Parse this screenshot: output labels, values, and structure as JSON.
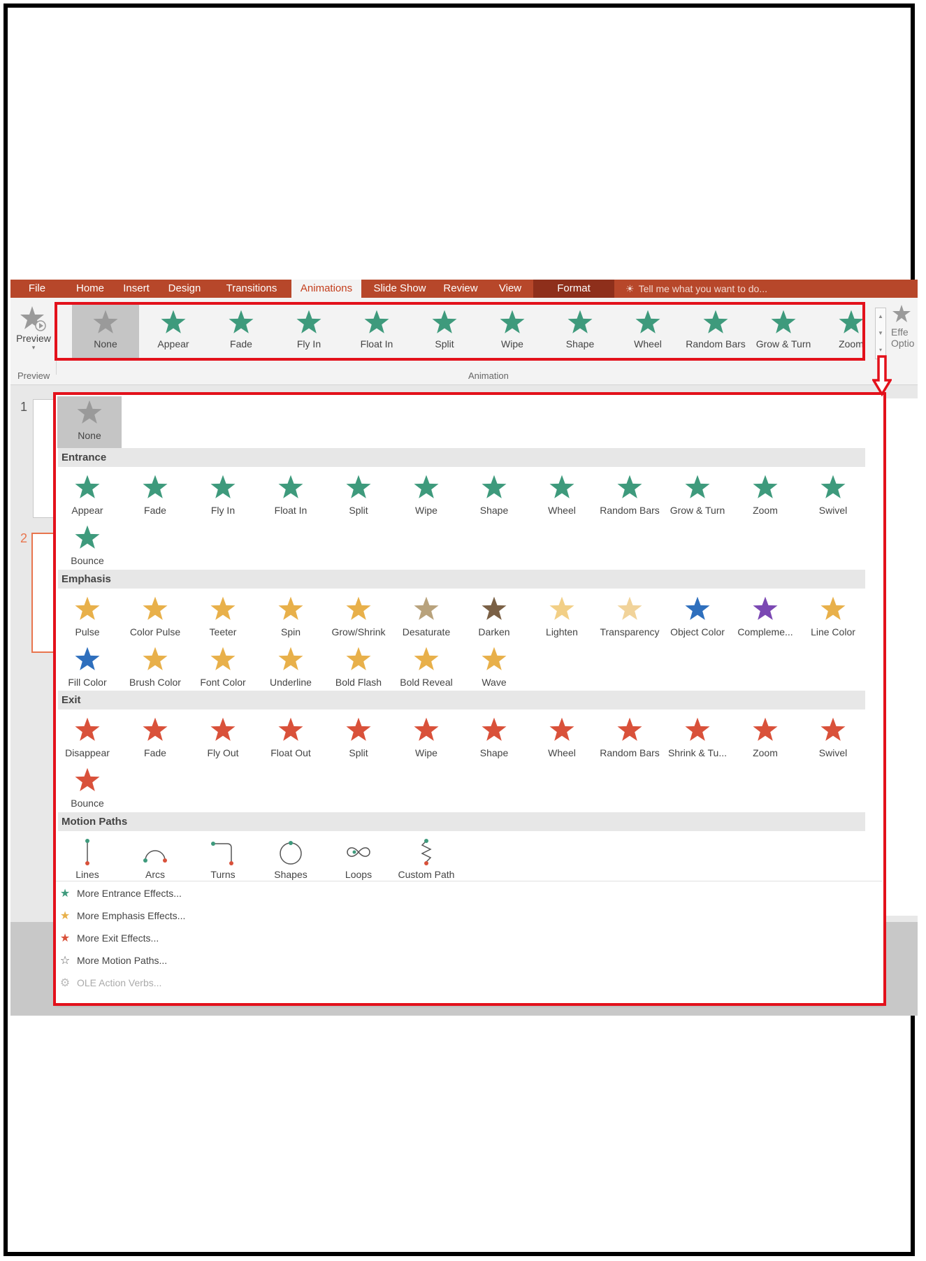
{
  "tabs": [
    {
      "label": "File"
    },
    {
      "label": "Home"
    },
    {
      "label": "Insert"
    },
    {
      "label": "Design"
    },
    {
      "label": "Transitions"
    },
    {
      "label": "Animations"
    },
    {
      "label": "Slide Show"
    },
    {
      "label": "Review"
    },
    {
      "label": "View"
    },
    {
      "label": "Format"
    }
  ],
  "tell_me": "Tell me what you want to do...",
  "preview": {
    "button_label": "Preview",
    "group_label": "Preview"
  },
  "ribbon_gallery": {
    "group_label": "Animation",
    "items": [
      "None",
      "Appear",
      "Fade",
      "Fly In",
      "Float In",
      "Split",
      "Wipe",
      "Shape",
      "Wheel",
      "Random Bars",
      "Grow & Turn",
      "Zoom"
    ]
  },
  "effect_options_partial": [
    "Effe",
    "Optio"
  ],
  "slide_numbers": [
    "1",
    "2"
  ],
  "panel": {
    "none_label": "None",
    "sections": [
      {
        "title": "Entrance",
        "items": [
          "Appear",
          "Fade",
          "Fly In",
          "Float In",
          "Split",
          "Wipe",
          "Shape",
          "Wheel",
          "Random Bars",
          "Grow & Turn",
          "Zoom",
          "Swivel",
          "Bounce"
        ]
      },
      {
        "title": "Emphasis",
        "items": [
          "Pulse",
          "Color Pulse",
          "Teeter",
          "Spin",
          "Grow/Shrink",
          "Desaturate",
          "Darken",
          "Lighten",
          "Transparency",
          "Object Color",
          "Compleme...",
          "Line Color",
          "Fill Color",
          "Brush Color",
          "Font Color",
          "Underline",
          "Bold Flash",
          "Bold Reveal",
          "Wave"
        ]
      },
      {
        "title": "Exit",
        "items": [
          "Disappear",
          "Fade",
          "Fly Out",
          "Float Out",
          "Split",
          "Wipe",
          "Shape",
          "Wheel",
          "Random Bars",
          "Shrink & Tu...",
          "Zoom",
          "Swivel",
          "Bounce"
        ]
      },
      {
        "title": "Motion Paths",
        "items": [
          "Lines",
          "Arcs",
          "Turns",
          "Shapes",
          "Loops",
          "Custom Path"
        ]
      }
    ],
    "more_links": [
      "More Entrance Effects...",
      "More Emphasis Effects...",
      "More Exit Effects...",
      "More Motion Paths...",
      "OLE Action Verbs..."
    ]
  },
  "colors": {
    "entrance": "#3e9a7c",
    "emphasis": "#e8b04a",
    "exit": "#d9513a",
    "accent": "#b7472a",
    "highlight": "#e3111b"
  }
}
